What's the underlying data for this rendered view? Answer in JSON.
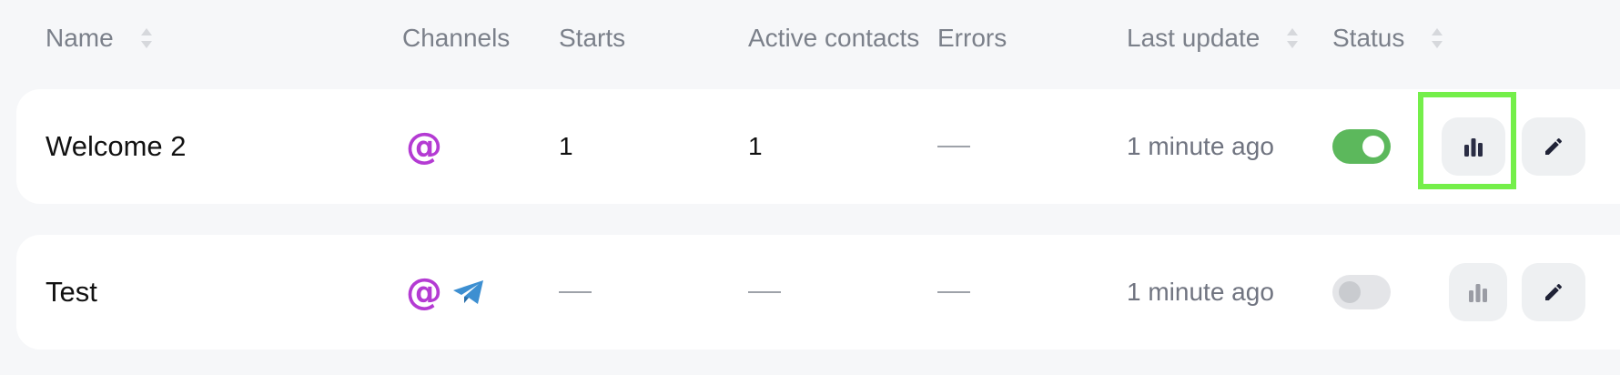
{
  "columns": {
    "name": "Name",
    "channels": "Channels",
    "starts": "Starts",
    "active_contacts": "Active contacts",
    "errors": "Errors",
    "last_update": "Last update",
    "status": "Status"
  },
  "rows": [
    {
      "name": "Welcome 2",
      "channels": [
        "email-at-icon"
      ],
      "starts": "1",
      "active_contacts": "1",
      "errors": "—",
      "last_update": "1 minute ago",
      "status": "on"
    },
    {
      "name": "Test",
      "channels": [
        "email-at-icon",
        "telegram-icon"
      ],
      "starts": "—",
      "active_contacts": "—",
      "errors": "—",
      "last_update": "1 minute ago",
      "status": "off"
    }
  ],
  "glyphs": {
    "at": "@"
  },
  "colors": {
    "email_icon": "#b43bd3",
    "telegram_icon": "#3d8fd1",
    "toggle_on": "#5cb85c",
    "toggle_off": "#e4e5e8",
    "highlight": "#74ef4a"
  }
}
